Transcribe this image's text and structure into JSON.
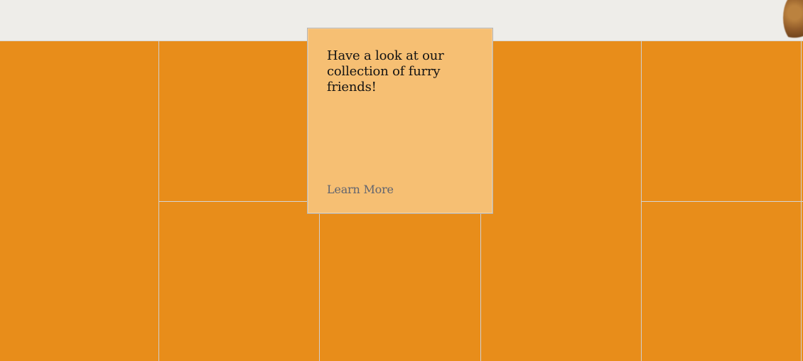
{
  "card": {
    "heading": "Have a look at our collection of furry friends!",
    "link_label": "Learn More"
  },
  "colors": {
    "page_background": "#efeeea",
    "tile_orange": "#e88d1a",
    "card_background": "#f6bf73",
    "grid_line": "#cfcfcf",
    "heading_text": "#131313",
    "link_text": "#62656f"
  }
}
